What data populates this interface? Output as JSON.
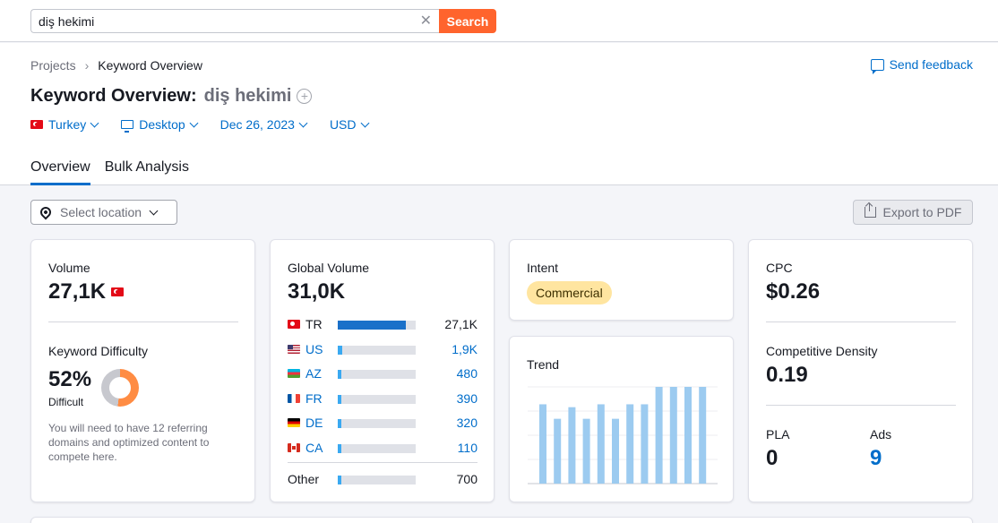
{
  "search": {
    "value": "diş hekimi",
    "button": "Search"
  },
  "breadcrumb": {
    "root": "Projects",
    "current": "Keyword Overview"
  },
  "feedback": "Send feedback",
  "title": {
    "prefix": "Keyword Overview:",
    "keyword": "diş hekimi"
  },
  "filters": {
    "country": "Turkey",
    "device": "Desktop",
    "date": "Dec 26, 2023",
    "currency": "USD"
  },
  "tabs": [
    "Overview",
    "Bulk Analysis"
  ],
  "location": {
    "placeholder": "Select location"
  },
  "export": "Export to PDF",
  "volume": {
    "label": "Volume",
    "value": "27,1K"
  },
  "kd": {
    "label": "Keyword Difficulty",
    "value": "52%",
    "level": "Difficult",
    "percent": 52,
    "color": "#ff8c43",
    "note": "You will need to have 12 referring domains and optimized content to compete here."
  },
  "global": {
    "label": "Global Volume",
    "value": "31,0K",
    "rows": [
      {
        "flag": "f-tr",
        "code": "TR",
        "value": "27,1K",
        "share": 0.874,
        "link": false
      },
      {
        "flag": "f-us",
        "code": "US",
        "value": "1,9K",
        "share": 0.06,
        "link": true
      },
      {
        "flag": "f-az",
        "code": "AZ",
        "value": "480",
        "share": 0.04,
        "link": true
      },
      {
        "flag": "f-fr",
        "code": "FR",
        "value": "390",
        "share": 0.04,
        "link": true
      },
      {
        "flag": "f-de",
        "code": "DE",
        "value": "320",
        "share": 0.04,
        "link": true
      },
      {
        "flag": "f-ca",
        "code": "CA",
        "value": "110",
        "share": 0.03,
        "link": true
      }
    ],
    "other": {
      "code": "Other",
      "value": "700",
      "share": 0.03
    }
  },
  "intent": {
    "label": "Intent",
    "value": "Commercial"
  },
  "trend": {
    "label": "Trend",
    "values": [
      0.82,
      0.67,
      0.79,
      0.67,
      0.82,
      0.67,
      0.82,
      0.82,
      1,
      1,
      1,
      1
    ]
  },
  "cpc": {
    "label": "CPC",
    "value": "$0.26"
  },
  "density": {
    "label": "Competitive Density",
    "value": "0.19"
  },
  "pla": {
    "label": "PLA",
    "value": "0"
  },
  "ads": {
    "label": "Ads",
    "value": "9"
  },
  "colors": {
    "accent": "#006dca",
    "bar_dark": "#1a70c9",
    "bar_light": "#3aa9f1",
    "trend": "#9ccbf0",
    "search": "#ff642d"
  }
}
